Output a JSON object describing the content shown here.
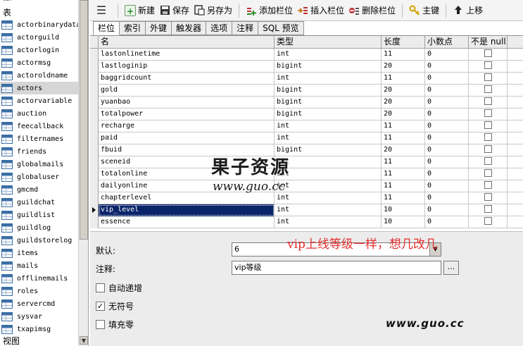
{
  "tree": {
    "top_cut_label": "tbl",
    "section_label": "表",
    "items": [
      "actorbinarydata",
      "actorguild",
      "actorlogin",
      "actormsg",
      "actoroldname",
      "actors",
      "actorvariable",
      "auction",
      "feecallback",
      "filternames",
      "friends",
      "globalmails",
      "globaluser",
      "gmcmd",
      "guildchat",
      "guildlist",
      "guildlog",
      "guildstorelog",
      "items",
      "mails",
      "offlinemails",
      "roles",
      "servercmd",
      "sysvar",
      "txapimsg"
    ],
    "selected": "actors",
    "views_label": "视图"
  },
  "toolbar": {
    "new": "新建",
    "save": "保存",
    "save_as": "另存为",
    "add_field": "添加栏位",
    "insert_field": "插入栏位",
    "delete_field": "删除栏位",
    "primary_key": "主键",
    "move_up": "上移"
  },
  "tabs": [
    "栏位",
    "索引",
    "外键",
    "触发器",
    "选项",
    "注释",
    "SQL 预览"
  ],
  "active_tab": "栏位",
  "grid": {
    "headers": {
      "name": "名",
      "type": "类型",
      "length": "长度",
      "decimals": "小数点",
      "not_null": "不是 null"
    },
    "rows": [
      {
        "name": "lastonlinetime",
        "type": "int",
        "length": "11",
        "decimals": "0"
      },
      {
        "name": "lastloginip",
        "type": "bigint",
        "length": "20",
        "decimals": "0"
      },
      {
        "name": "baggridcount",
        "type": "int",
        "length": "11",
        "decimals": "0"
      },
      {
        "name": "gold",
        "type": "bigint",
        "length": "20",
        "decimals": "0"
      },
      {
        "name": "yuanbao",
        "type": "bigint",
        "length": "20",
        "decimals": "0"
      },
      {
        "name": "totalpower",
        "type": "bigint",
        "length": "20",
        "decimals": "0"
      },
      {
        "name": "recharge",
        "type": "int",
        "length": "11",
        "decimals": "0"
      },
      {
        "name": "paid",
        "type": "int",
        "length": "11",
        "decimals": "0"
      },
      {
        "name": "fbuid",
        "type": "bigint",
        "length": "20",
        "decimals": "0"
      },
      {
        "name": "sceneid",
        "type": "int",
        "length": "11",
        "decimals": "0"
      },
      {
        "name": "totalonline",
        "type": "int",
        "length": "11",
        "decimals": "0"
      },
      {
        "name": "dailyonline",
        "type": "int",
        "length": "11",
        "decimals": "0"
      },
      {
        "name": "chapterlevel",
        "type": "int",
        "length": "11",
        "decimals": "0"
      },
      {
        "name": "vip_level",
        "type": "int",
        "length": "10",
        "decimals": "0"
      },
      {
        "name": "essence",
        "type": "int",
        "length": "10",
        "decimals": "0"
      }
    ],
    "selected_row": "vip_level"
  },
  "props": {
    "default_label": "默认:",
    "default_value": "6",
    "comment_label": "注释:",
    "comment_value": "vip等级",
    "dots_button": "...",
    "auto_increment_label": "自动递增",
    "auto_increment_checked": false,
    "unsigned_label": "无符号",
    "unsigned_checked": true,
    "zerofill_label": "填充零",
    "zerofill_checked": false
  },
  "annotation": "vip上线等级一样，想几改几",
  "watermark": {
    "title": "果子资源",
    "url": "www.guo.cc",
    "url_bottom": "www.guo.cc"
  },
  "colors": {
    "selection": "#0a246a",
    "annotation": "#e53030"
  }
}
